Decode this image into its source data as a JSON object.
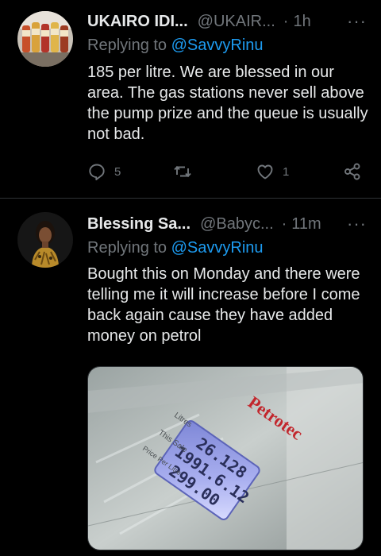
{
  "tweets": [
    {
      "name": "UKAIRO IDI...",
      "handle": "@UKAIR...",
      "dot": "·",
      "time": "1h",
      "more": "···",
      "replying_prefix": "Replying to ",
      "replying_to": "@SavvyRinu",
      "text": "185 per litre.  We are blessed in our area.  The gas stations never sell above the pump prize and the queue is usually not bad.",
      "reply_count": "5",
      "retweet_count": "",
      "like_count": "1"
    },
    {
      "name": "Blessing Sa...",
      "handle": "@Babyc...",
      "dot": "·",
      "time": "11m",
      "more": "···",
      "replying_prefix": "Replying to ",
      "replying_to": "@SavvyRinu",
      "text": "Bought this on Monday and there were telling me it will increase before I come back again cause they have added money on petrol",
      "media": {
        "brand": "Petrotec",
        "label_litres": "Litres",
        "label_sale": "This Sale",
        "label_price": "Price Per Litre",
        "reading_litres": "26.128",
        "reading_sale": "1991.6.12",
        "reading_price": "299.00"
      }
    }
  ],
  "icons": {
    "reply": "reply-icon",
    "retweet": "retweet-icon",
    "like": "heart-icon",
    "share": "share-icon"
  },
  "colors": {
    "background": "#000000",
    "text": "#e7e9ea",
    "muted": "#71767b",
    "link": "#1d9bf0",
    "divider": "#2f3336"
  }
}
